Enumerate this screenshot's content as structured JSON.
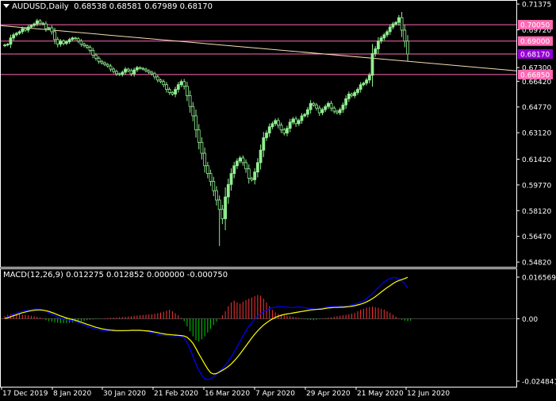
{
  "header": {
    "symbol_label": "AUDUSD,Daily",
    "ohlc": "0.68538 0.68581 0.67989 0.68170"
  },
  "macd_header": {
    "label": "MACD(12,26,9) 0.012275 0.012852 0.000000 -0.000750"
  },
  "colors": {
    "background": "#000000",
    "frame": "#ffffff",
    "candle": "#90ee90",
    "trendline": "#f5deb3",
    "hline": "#ff69b4",
    "price_tag": "#ff69b4",
    "current_tag": "#9400d3",
    "macd_line": "#0000ff",
    "signal_line": "#ffff00",
    "hist_pos": "#ff3333",
    "hist_neg": "#00cc00"
  },
  "chart_data": [
    {
      "type": "candlestick",
      "title": "AUDUSD,Daily",
      "ylim": [
        0.5467,
        0.7138
      ],
      "y_ticks": [
        "0.71375",
        "0.69720",
        "0.67300",
        "0.66420",
        "0.64770",
        "0.63120",
        "0.61420",
        "0.59770",
        "0.58120",
        "0.56470",
        "0.54820"
      ],
      "x_ticks": [
        "17 Dec 2019",
        "8 Jan 2020",
        "30 Jan 2020",
        "21 Feb 2020",
        "16 Mar 2020",
        "7 Apr 2020",
        "29 Apr 2020",
        "21 May 2020",
        "12 Jun 2020"
      ],
      "levels": [
        {
          "label": "0.70050",
          "value": 0.7005,
          "tag": "level"
        },
        {
          "label": "0.69000",
          "value": 0.69,
          "tag": "level"
        },
        {
          "label": "0.68170",
          "value": 0.6817,
          "tag": "current"
        },
        {
          "label": "0.66850",
          "value": 0.6685,
          "tag": "level"
        }
      ],
      "trendline": {
        "from": {
          "x": "17 Dec 2019",
          "y": 0.6999
        },
        "to": {
          "x": "12 Jun 2020",
          "y": 0.6709
        }
      },
      "closes": [
        0.6875,
        0.688,
        0.692,
        0.694,
        0.695,
        0.696,
        0.698,
        0.697,
        0.699,
        0.7,
        0.701,
        0.703,
        0.7015,
        0.701,
        0.698,
        0.6985,
        0.696,
        0.691,
        0.688,
        0.69,
        0.6885,
        0.6895,
        0.691,
        0.692,
        0.6915,
        0.69,
        0.688,
        0.687,
        0.686,
        0.684,
        0.681,
        0.679,
        0.677,
        0.676,
        0.675,
        0.674,
        0.672,
        0.6705,
        0.669,
        0.6685,
        0.67,
        0.672,
        0.671,
        0.669,
        0.6715,
        0.673,
        0.6725,
        0.672,
        0.671,
        0.67,
        0.669,
        0.667,
        0.665,
        0.664,
        0.662,
        0.659,
        0.657,
        0.656,
        0.659,
        0.662,
        0.664,
        0.661,
        0.655,
        0.648,
        0.642,
        0.633,
        0.625,
        0.618,
        0.61,
        0.605,
        0.6,
        0.594,
        0.588,
        0.582,
        0.576,
        0.59,
        0.598,
        0.605,
        0.61,
        0.613,
        0.615,
        0.612,
        0.608,
        0.602,
        0.601,
        0.606,
        0.612,
        0.62,
        0.628,
        0.631,
        0.635,
        0.637,
        0.639,
        0.636,
        0.633,
        0.631,
        0.634,
        0.638,
        0.64,
        0.637,
        0.639,
        0.642,
        0.643,
        0.646,
        0.65,
        0.649,
        0.647,
        0.644,
        0.646,
        0.648,
        0.65,
        0.647,
        0.645,
        0.644,
        0.646,
        0.649,
        0.653,
        0.656,
        0.655,
        0.657,
        0.659,
        0.662,
        0.663,
        0.665,
        0.668,
        0.682,
        0.685,
        0.69,
        0.692,
        0.694,
        0.696,
        0.699,
        0.701,
        0.702,
        0.705,
        0.697,
        0.69,
        0.6817
      ]
    },
    {
      "type": "macd",
      "title": "MACD(12,26,9)",
      "ylim": [
        -0.024841,
        0.016569
      ],
      "y_ticks": [
        "0.016569",
        "0.00",
        "-0.024841"
      ],
      "series": [
        {
          "key": "macd",
          "values": [
            0.0002,
            0.0008,
            0.0013,
            0.0018,
            0.0022,
            0.0026,
            0.003,
            0.0032,
            0.0034,
            0.0036,
            0.0038,
            0.0039,
            0.0038,
            0.0035,
            0.003,
            0.0024,
            0.0018,
            0.0012,
            0.0006,
            0.0002,
            -0.0002,
            -0.0004,
            -0.0006,
            -0.0008,
            -0.0011,
            -0.0015,
            -0.002,
            -0.0025,
            -0.003,
            -0.0034,
            -0.0038,
            -0.0041,
            -0.0044,
            -0.0046,
            -0.0047,
            -0.0048,
            -0.0049,
            -0.005,
            -0.005,
            -0.005,
            -0.0049,
            -0.0048,
            -0.0047,
            -0.0046,
            -0.0046,
            -0.0046,
            -0.0047,
            -0.0048,
            -0.005,
            -0.0052,
            -0.0055,
            -0.0058,
            -0.0062,
            -0.0065,
            -0.0066,
            -0.0067,
            -0.0068,
            -0.0068,
            -0.0068,
            -0.0068,
            -0.007,
            -0.0078,
            -0.0095,
            -0.012,
            -0.015,
            -0.018,
            -0.0205,
            -0.0225,
            -0.0238,
            -0.0242,
            -0.024,
            -0.0232,
            -0.022,
            -0.0208,
            -0.0198,
            -0.0185,
            -0.017,
            -0.0152,
            -0.0132,
            -0.0112,
            -0.009,
            -0.0068,
            -0.0048,
            -0.003,
            -0.0015,
            -0.0002,
            0.001,
            0.002,
            0.0028,
            0.0034,
            0.004,
            0.0044,
            0.0046,
            0.0047,
            0.0048,
            0.0047,
            0.0046,
            0.0045,
            0.0045,
            0.0046,
            0.0047,
            0.0046,
            0.0044,
            0.0042,
            0.004,
            0.0039,
            0.0038,
            0.004,
            0.0043,
            0.0046,
            0.0048,
            0.0049,
            0.0049,
            0.0049,
            0.0049,
            0.0049,
            0.005,
            0.0052,
            0.0055,
            0.0058,
            0.0062,
            0.0066,
            0.0072,
            0.008,
            0.009,
            0.01,
            0.0112,
            0.0124,
            0.0136,
            0.0146,
            0.0154,
            0.016,
            0.0164,
            0.0163,
            0.0158,
            0.015,
            0.014,
            0.0123
          ]
        },
        {
          "key": "signal",
          "values": [
            0.0001,
            0.0004,
            0.0008,
            0.0012,
            0.0016,
            0.002,
            0.0024,
            0.0027,
            0.003,
            0.0032,
            0.0034,
            0.0035,
            0.0035,
            0.0034,
            0.0032,
            0.0029,
            0.0025,
            0.0021,
            0.0016,
            0.0011,
            0.0007,
            0.0003,
            0.0,
            -0.0003,
            -0.0006,
            -0.001,
            -0.0014,
            -0.0018,
            -0.0022,
            -0.0026,
            -0.003,
            -0.0034,
            -0.0037,
            -0.004,
            -0.0042,
            -0.0044,
            -0.0045,
            -0.0046,
            -0.0047,
            -0.0047,
            -0.0047,
            -0.0047,
            -0.0047,
            -0.0046,
            -0.0046,
            -0.0046,
            -0.0046,
            -0.0047,
            -0.0048,
            -0.0049,
            -0.0051,
            -0.0053,
            -0.0055,
            -0.0058,
            -0.006,
            -0.0062,
            -0.0063,
            -0.0064,
            -0.0065,
            -0.0066,
            -0.0067,
            -0.0069,
            -0.0074,
            -0.0084,
            -0.0098,
            -0.0118,
            -0.014,
            -0.016,
            -0.018,
            -0.02,
            -0.0215,
            -0.022,
            -0.0218,
            -0.0212,
            -0.0205,
            -0.0198,
            -0.019,
            -0.018,
            -0.0168,
            -0.0155,
            -0.014,
            -0.0124,
            -0.0108,
            -0.0092,
            -0.0076,
            -0.0061,
            -0.0048,
            -0.0036,
            -0.0025,
            -0.0016,
            -0.0008,
            -0.0001,
            0.0005,
            0.001,
            0.0014,
            0.0017,
            0.0019,
            0.0021,
            0.0023,
            0.0025,
            0.0027,
            0.0029,
            0.0031,
            0.0033,
            0.0035,
            0.0036,
            0.0037,
            0.0038,
            0.0039,
            0.0041,
            0.0043,
            0.0044,
            0.0045,
            0.0045,
            0.0046,
            0.0046,
            0.0047,
            0.0048,
            0.005,
            0.0052,
            0.0055,
            0.0058,
            0.0062,
            0.0067,
            0.0073,
            0.008,
            0.0088,
            0.0097,
            0.0106,
            0.0115,
            0.0124,
            0.0132,
            0.014,
            0.0147,
            0.0152,
            0.0156,
            0.016,
            0.0165
          ]
        },
        {
          "key": "histogram",
          "values": [
            0.001,
            0.0016,
            0.0018,
            0.002,
            0.0019,
            0.0018,
            0.0016,
            0.0015,
            0.0014,
            0.0012,
            0.001,
            0.0008,
            0.0005,
            0.0002,
            -0.0006,
            -0.001,
            -0.0012,
            -0.0014,
            -0.0016,
            -0.0017,
            -0.0018,
            -0.0017,
            -0.0016,
            -0.0015,
            -0.0014,
            -0.0012,
            -0.001,
            -0.0008,
            -0.0006,
            -0.0004,
            -0.0003,
            -0.0002,
            -0.0001,
            0.0001,
            0.0002,
            0.0003,
            0.0004,
            0.0005,
            0.0005,
            0.0006,
            0.0007,
            0.0008,
            0.0009,
            0.001,
            0.0012,
            0.0013,
            0.0014,
            0.0015,
            0.0016,
            0.0017,
            0.0018,
            0.002,
            0.0022,
            0.0025,
            0.0028,
            0.0032,
            0.0036,
            0.003,
            0.0022,
            0.0014,
            0.0004,
            -0.001,
            -0.003,
            -0.005,
            -0.007,
            -0.0085,
            -0.009,
            -0.0082,
            -0.007,
            -0.0055,
            -0.004,
            -0.0025,
            -0.0012,
            0.0002,
            0.0014,
            0.003,
            0.005,
            0.0065,
            0.0072,
            0.0065,
            0.006,
            0.0068,
            0.0075,
            0.008,
            0.0085,
            0.009,
            0.0095,
            0.0092,
            0.008,
            0.0065,
            0.005,
            0.0035,
            0.0025,
            0.002,
            0.0016,
            0.0014,
            0.0012,
            0.001,
            0.0008,
            0.0006,
            0.0004,
            0.0002,
            -0.0002,
            -0.0004,
            -0.0005,
            -0.0006,
            -0.0004,
            -0.0002,
            0.0001,
            0.0003,
            0.0004,
            0.0006,
            0.0008,
            0.001,
            0.0012,
            0.0014,
            0.0016,
            0.0018,
            0.002,
            0.0024,
            0.003,
            0.0036,
            0.004,
            0.0044,
            0.0046,
            0.0048,
            0.0046,
            0.0044,
            0.004,
            0.0036,
            0.003,
            0.0024,
            0.0016,
            0.0008,
            0.0002,
            -0.0004,
            -0.0008,
            -0.001,
            -0.0008
          ]
        }
      ]
    }
  ]
}
